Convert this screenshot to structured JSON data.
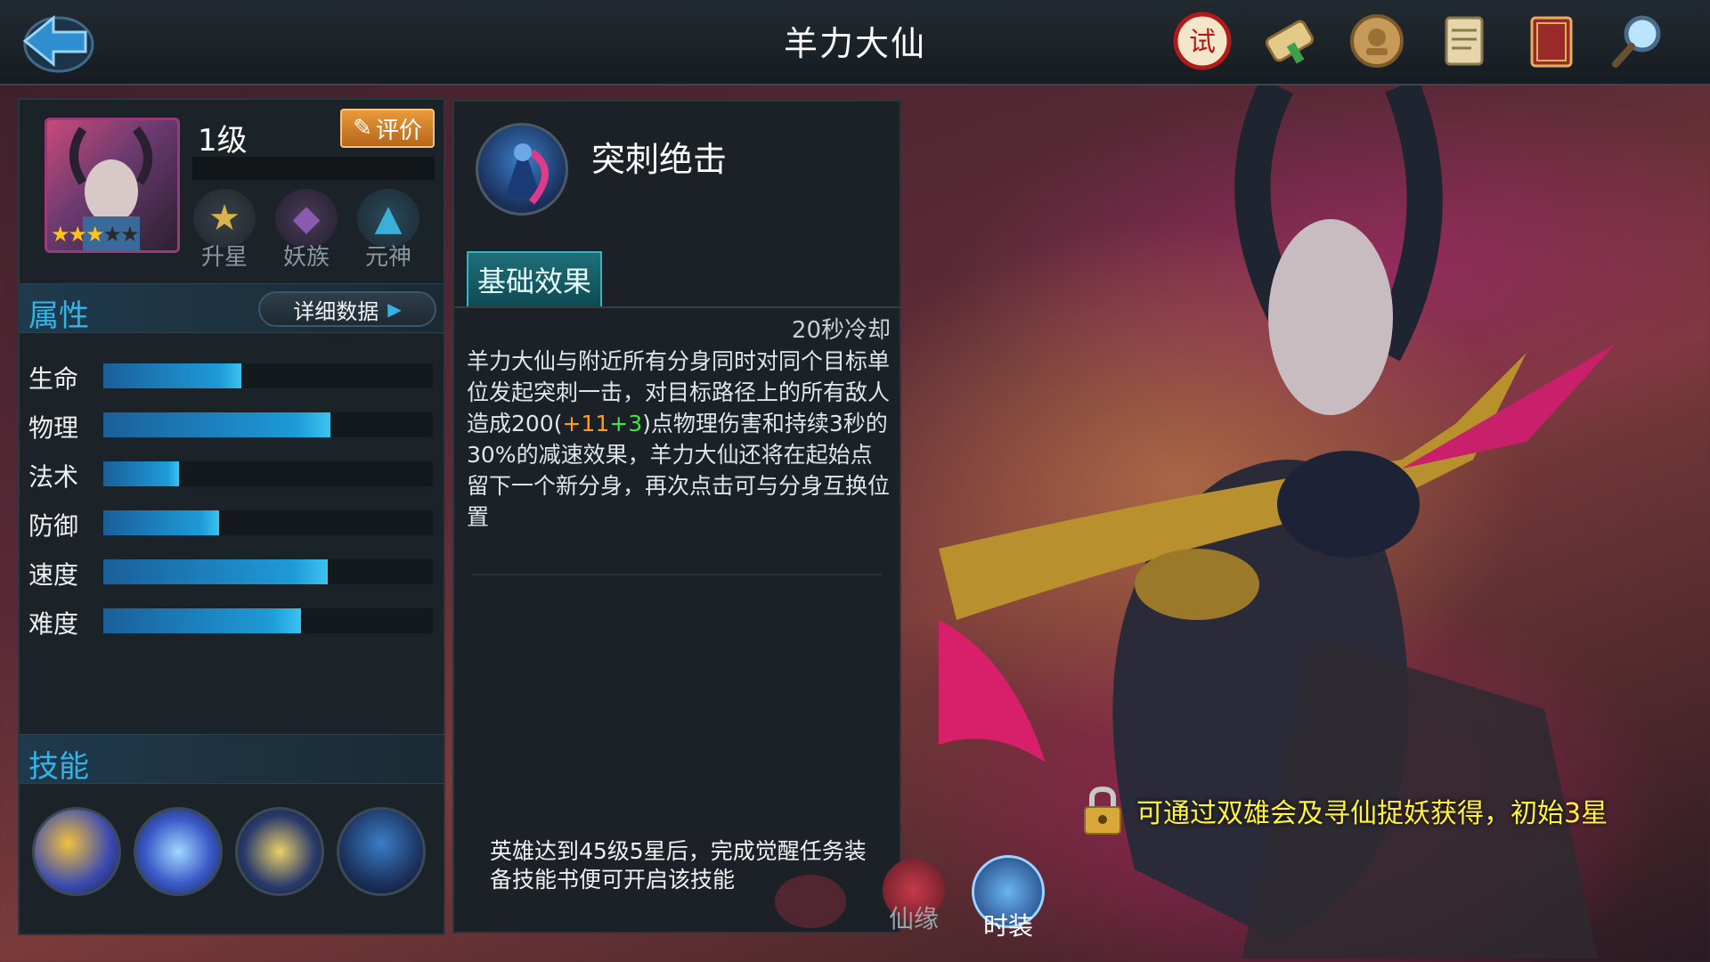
{
  "header": {
    "title": "羊力大仙",
    "icons": [
      {
        "name": "trial-seal-icon",
        "color": "#b21a1a",
        "glyph": "试"
      },
      {
        "name": "scroll-icon",
        "color": "#d6b46a"
      },
      {
        "name": "medal-icon",
        "color": "#c89a5a"
      },
      {
        "name": "document-icon",
        "color": "#d8c69a"
      },
      {
        "name": "book-icon",
        "color": "#9a2a2a"
      },
      {
        "name": "magnifier-icon",
        "color": "#4a9ad8"
      }
    ]
  },
  "hero": {
    "level_label": "1级",
    "stars_filled": 3,
    "stars_total": 5,
    "rate_button": "评价",
    "badges": [
      {
        "label": "升星",
        "icon": "star-upgrade-icon"
      },
      {
        "label": "妖族",
        "icon": "demon-clan-icon"
      },
      {
        "label": "元神",
        "icon": "spirit-flame-icon"
      }
    ]
  },
  "attributes": {
    "title": "属性",
    "detail_button": "详细数据",
    "stats": [
      {
        "name": "生命",
        "value": 0.42
      },
      {
        "name": "物理",
        "value": 0.69
      },
      {
        "name": "法术",
        "value": 0.23
      },
      {
        "name": "防御",
        "value": 0.35
      },
      {
        "name": "速度",
        "value": 0.68
      },
      {
        "name": "难度",
        "value": 0.6
      }
    ]
  },
  "skills": {
    "title": "技能",
    "icons": [
      "skill-1-icon",
      "skill-2-icon",
      "skill-3-icon",
      "skill-4-icon"
    ]
  },
  "skill_detail": {
    "name": "突刺绝击",
    "tab_label": "基础效果",
    "cooldown": "20秒冷却",
    "desc_part1": "羊力大仙与附近所有分身同时对同个目标单位发起突刺一击，对目标路径上的所有敌人造成200(",
    "desc_orange": "+11",
    "desc_green": "+3",
    "desc_part2": ")点物理伤害和持续3秒的30%的减速效果，羊力大仙还将在起始点留下一个新分身，再次点击可与分身互换位置",
    "unlock_text": "英雄达到45级5星后，完成觉醒任务装备技能书便可开启该技能"
  },
  "scene": {
    "obtain_text": "可通过双雄会及寻仙捉妖获得，初始3星",
    "bottom_tabs": [
      {
        "label": "仙缘"
      },
      {
        "label": "时装"
      }
    ]
  },
  "colors": {
    "accent": "#33b4e8",
    "bar_fill": "#1e9bd8",
    "obtain_text": "#fff33a",
    "bonus_orange": "#ff9a1a",
    "bonus_green": "#3ee83e"
  }
}
